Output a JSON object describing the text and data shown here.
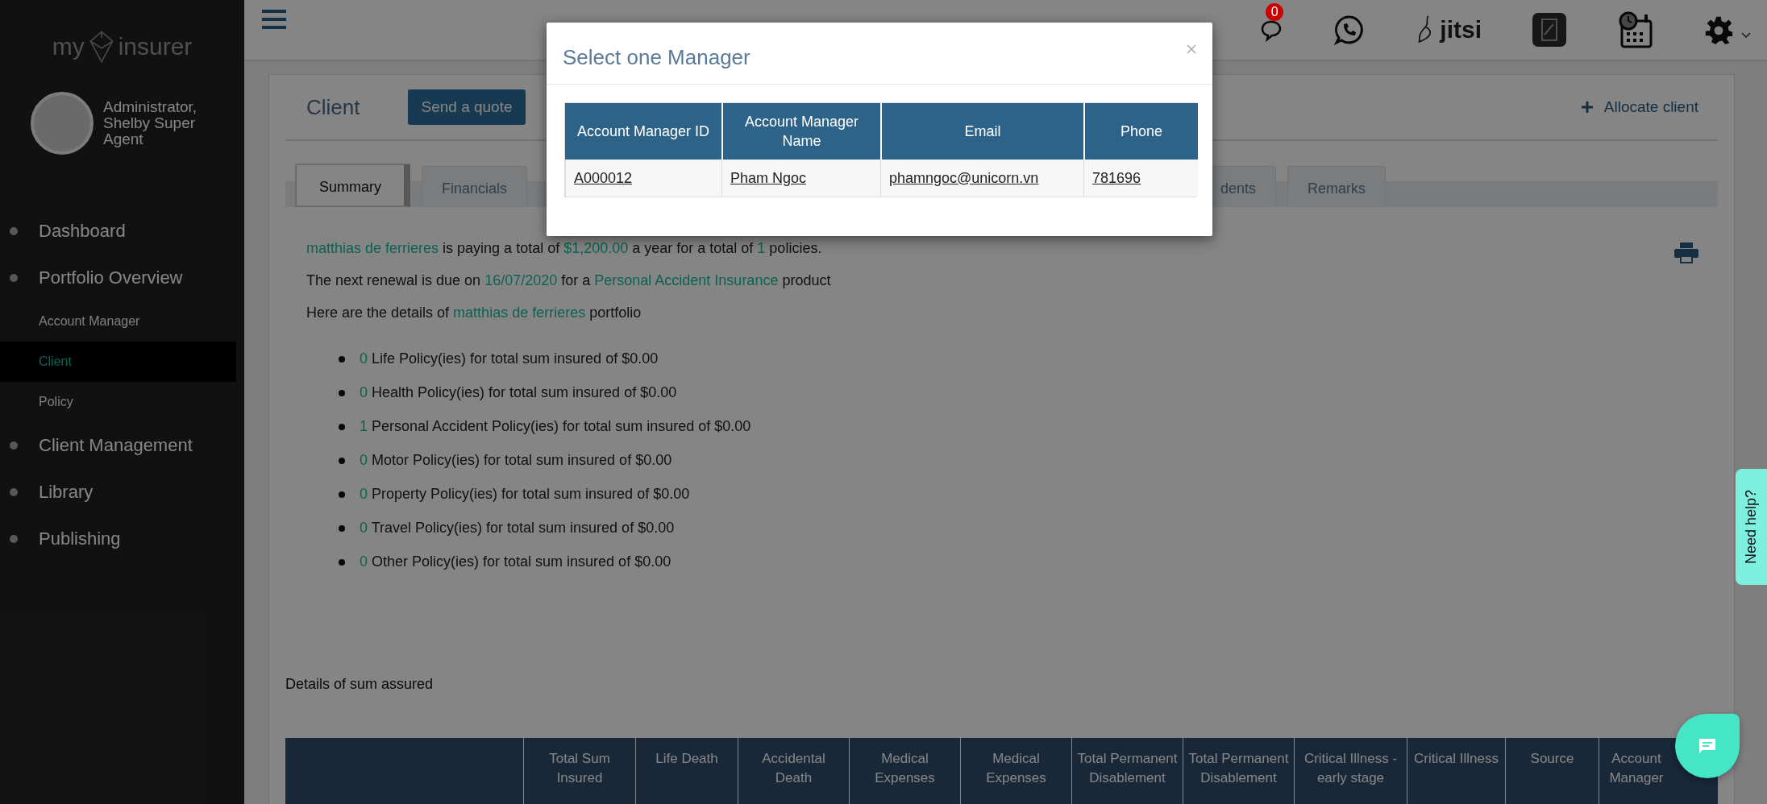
{
  "sidebar": {
    "logo": {
      "left": "my",
      "right": "insurer"
    },
    "user": {
      "name": "Administrator, Shelby Super Agent"
    },
    "items": [
      {
        "label": "Dashboard",
        "selected": false
      },
      {
        "label": "Portfolio Overview",
        "selected": false,
        "children": [
          {
            "label": "Account Manager",
            "selected": false
          },
          {
            "label": "Client",
            "selected": true
          },
          {
            "label": "Policy",
            "selected": false
          }
        ]
      },
      {
        "label": "Client Management",
        "selected": false
      },
      {
        "label": "Library",
        "selected": false
      },
      {
        "label": "Publishing",
        "selected": false
      }
    ]
  },
  "topbar": {
    "notification_count": "0",
    "jitsi": "jitsi"
  },
  "page": {
    "title": "Client",
    "quote_button": "Send a quote",
    "allocate_link": "Allocate client",
    "tabs": [
      {
        "label": "Summary",
        "selected": true
      },
      {
        "label": "Financials",
        "selected": false
      },
      {
        "label": "dents",
        "selected": false
      },
      {
        "label": "Remarks",
        "selected": false
      }
    ],
    "summary": [
      [
        {
          "text": "matthias de ferrieres",
          "highlight": true
        },
        {
          "text": " is paying a total of ",
          "highlight": false
        },
        {
          "text": "$1,200.00",
          "highlight": true
        },
        {
          "text": " a year for a total of ",
          "highlight": false
        },
        {
          "text": "1",
          "highlight": true
        },
        {
          "text": " policies.",
          "highlight": false
        }
      ],
      [
        {
          "text": "The next renewal is due on ",
          "highlight": false
        },
        {
          "text": "16/07/2020",
          "highlight": true
        },
        {
          "text": " for a ",
          "highlight": false
        },
        {
          "text": "Personal Accident Insurance",
          "highlight": true
        },
        {
          "text": " product",
          "highlight": false
        }
      ],
      [
        {
          "text": "Here are the details of ",
          "highlight": false
        },
        {
          "text": "matthias de ferrieres",
          "highlight": true
        },
        {
          "text": " portfolio",
          "highlight": false
        }
      ]
    ],
    "policies": [
      {
        "count": "0",
        "text": "Life Policy(ies) for total sum insured of $0.00"
      },
      {
        "count": "0",
        "text": "Health Policy(ies) for total sum insured of $0.00"
      },
      {
        "count": "1",
        "text": "Personal Accident Policy(ies) for total sum insured of $0.00"
      },
      {
        "count": "0",
        "text": "Motor Policy(ies) for total sum insured of $0.00"
      },
      {
        "count": "0",
        "text": "Property Policy(ies) for total sum insured of $0.00"
      },
      {
        "count": "0",
        "text": "Travel Policy(ies) for total sum insured of $0.00"
      },
      {
        "count": "0",
        "text": "Other Policy(ies) for total sum insured of $0.00"
      }
    ],
    "sum_assured": {
      "title": "Details of sum assured",
      "columns": [
        "",
        "Total Sum Insured",
        "Life Death",
        "Accidental Death",
        "Medical Expenses",
        "Medical Expenses",
        "Total Permanent Disablement",
        "Total Permanent Disablement",
        "Critical Illness - early stage",
        "Critical Illness",
        "Source",
        "Account Manager"
      ]
    }
  },
  "modal": {
    "title": "Select one Manager",
    "columns": [
      "Account Manager ID",
      "Account Manager Name",
      "Email",
      "Phone"
    ],
    "rows": [
      [
        "A000012",
        "Pham Ngoc",
        "phamngoc@unicorn.vn",
        "781696"
      ]
    ]
  },
  "help_tab": "Need help?"
}
